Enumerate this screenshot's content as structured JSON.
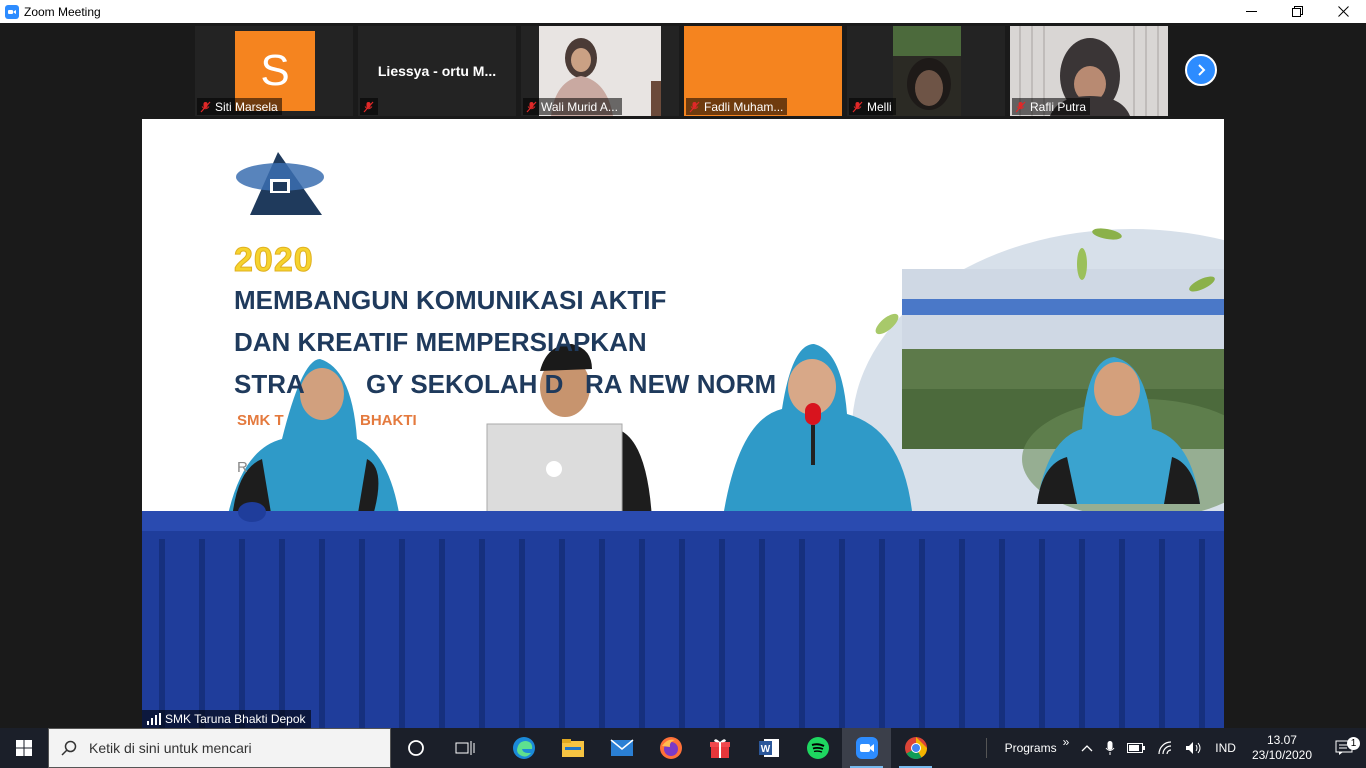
{
  "window": {
    "title": "Zoom Meeting"
  },
  "gallery": [
    {
      "name": "Siti Marsela",
      "avatar_letter": "S",
      "type": "avatar"
    },
    {
      "name": "",
      "display_name": "Liessya - ortu M...",
      "type": "name-only"
    },
    {
      "name": "Wali Murid A...",
      "type": "video"
    },
    {
      "name": "Fadli Muham...",
      "type": "orange"
    },
    {
      "name": "Melli",
      "type": "video"
    },
    {
      "name": "Rafli Putra",
      "type": "video"
    }
  ],
  "slide": {
    "year": "2020",
    "line1": "MEMBANGUN KOMUNIKASI AKTIF",
    "line2": "DAN KREATIF MEMPERSIAPKAN",
    "line3": "STRA",
    "line3b": "GY SEKOLAH D",
    "line3c": "RA NEW NORM",
    "sub_a": "SMK T",
    "sub_b": "BHAKTI",
    "r_letter": "R"
  },
  "active_speaker": {
    "name": "SMK Taruna Bhakti Depok"
  },
  "taskbar": {
    "search_placeholder": "Ketik di sini untuk mencari",
    "programs_label": "Programs",
    "language": "IND",
    "time": "13.07",
    "date": "23/10/2020",
    "notification_count": "1"
  },
  "colors": {
    "zoom_blue": "#2d8cff",
    "avatar_orange": "#f5841f",
    "taskbar_bg": "#1b1f29",
    "table_blue": "#1f3d9b"
  }
}
